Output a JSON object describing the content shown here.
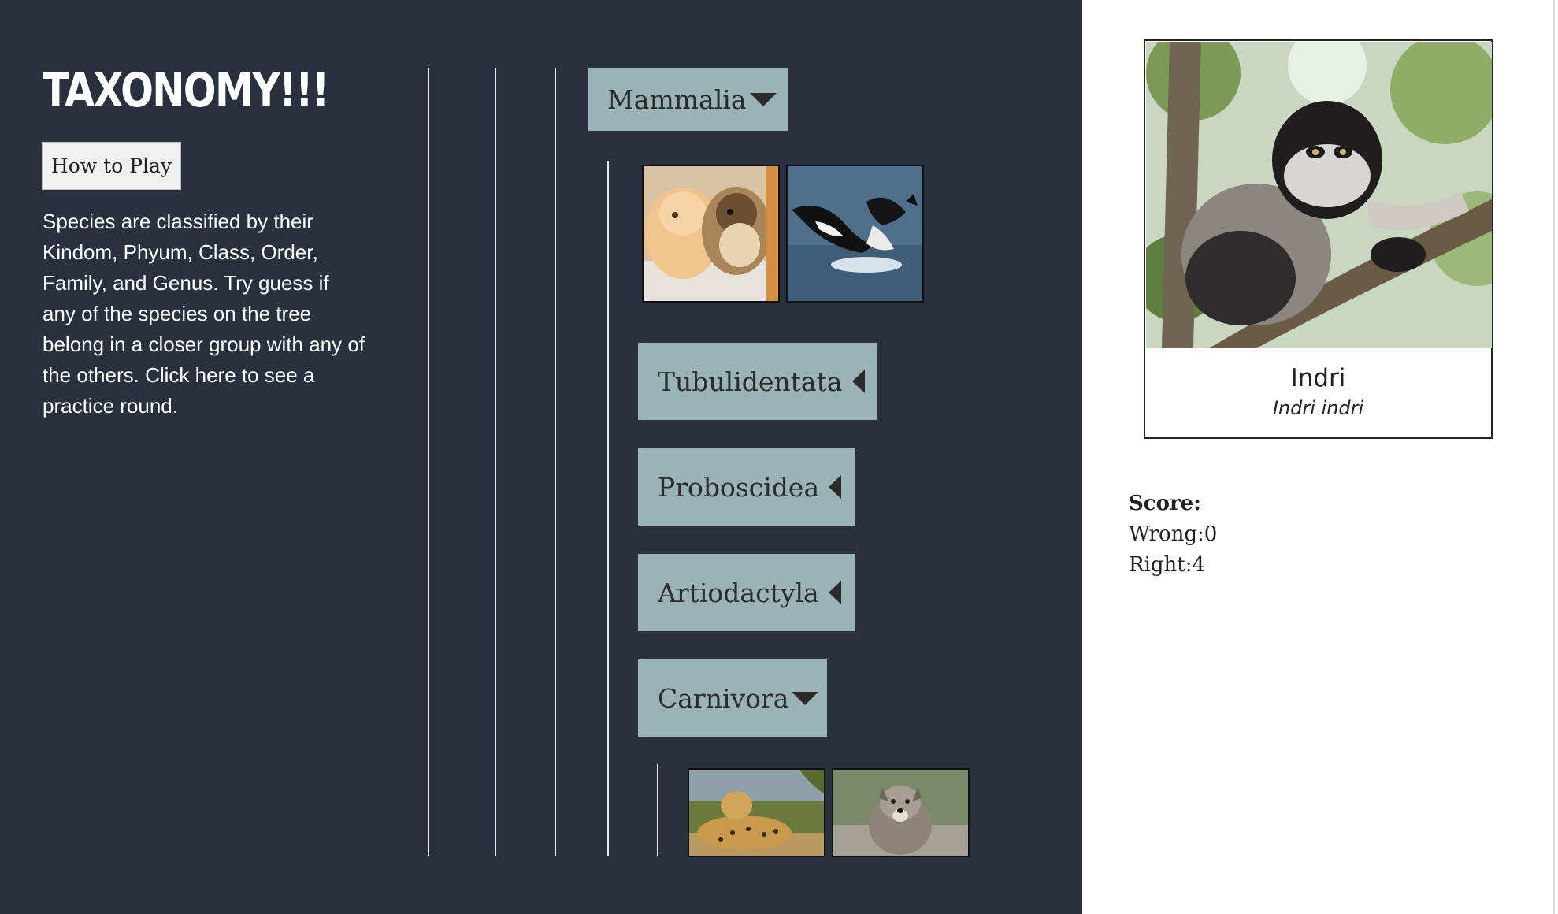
{
  "header": {
    "title": "TAXONOMY!!!"
  },
  "controls": {
    "how_to_play_label": "How to Play"
  },
  "instructions": {
    "text": "Species are classified by their Kindom, Phyum, Class, Order, Family, and Genus. Try guess if any of the species on the tree belong in a closer group with any of the others. Click here to see a practice round."
  },
  "tree": {
    "class": {
      "label": "Mammalia",
      "state": "expanded",
      "icon": "caret-down-icon"
    },
    "class_species": [
      {
        "name": "guinea-pigs-photo"
      },
      {
        "name": "orca-photo"
      }
    ],
    "orders": [
      {
        "label": "Tubulidentata",
        "state": "collapsed",
        "icon": "caret-left-icon"
      },
      {
        "label": "Proboscidea",
        "state": "collapsed",
        "icon": "caret-left-icon"
      },
      {
        "label": "Artiodactyla",
        "state": "collapsed",
        "icon": "caret-left-icon"
      },
      {
        "label": "Carnivora",
        "state": "expanded",
        "icon": "caret-down-icon"
      }
    ],
    "carnivora_species": [
      {
        "name": "leopard-photo"
      },
      {
        "name": "wolf-photo"
      }
    ]
  },
  "current_species": {
    "common_name": "Indri",
    "scientific_name": "Indri indri"
  },
  "score": {
    "heading": "Score:",
    "wrong_text": "Wrong:0",
    "right_text": "Right:4"
  },
  "colors": {
    "panel_bg": "#29313f",
    "taxon_bg": "#9ab3b6",
    "tree_line": "#e9e9e9"
  }
}
